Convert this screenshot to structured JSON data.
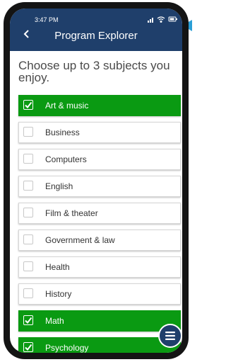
{
  "status_bar": {
    "time": "3:47 PM"
  },
  "header": {
    "back_icon": "chevron-left-icon",
    "title": "Program Explorer"
  },
  "prompt": "Choose up to 3 subjects you enjoy.",
  "subjects": [
    {
      "label": "Art & music",
      "checked": true
    },
    {
      "label": "Business",
      "checked": false
    },
    {
      "label": "Computers",
      "checked": false
    },
    {
      "label": "English",
      "checked": false
    },
    {
      "label": "Film & theater",
      "checked": false
    },
    {
      "label": "Government & law",
      "checked": false
    },
    {
      "label": "Health",
      "checked": false
    },
    {
      "label": "History",
      "checked": false
    },
    {
      "label": "Math",
      "checked": true
    },
    {
      "label": "Psychology",
      "checked": true
    }
  ],
  "menu_button": {
    "icon": "menu-icon"
  },
  "colors": {
    "header": "#1f3f6b",
    "selected": "#0a9a12",
    "accent_arrow": "#2a9fd6"
  }
}
